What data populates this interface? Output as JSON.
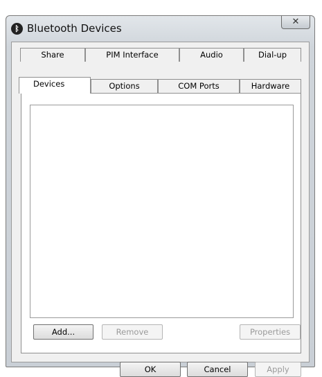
{
  "window": {
    "title": "Bluetooth Devices",
    "close_label": "✕",
    "icon": "bluetooth-icon"
  },
  "tabs": {
    "row_back": [
      {
        "label": "Share"
      },
      {
        "label": "PIM Interface"
      },
      {
        "label": "Audio"
      },
      {
        "label": "Dial-up"
      }
    ],
    "row_front": [
      {
        "label": "Devices",
        "active": true
      },
      {
        "label": "Options"
      },
      {
        "label": "COM Ports"
      },
      {
        "label": "Hardware"
      }
    ]
  },
  "devices_panel": {
    "add_label": "Add...",
    "remove_label": "Remove",
    "properties_label": "Properties"
  },
  "footer": {
    "ok_label": "OK",
    "cancel_label": "Cancel",
    "apply_label": "Apply"
  }
}
